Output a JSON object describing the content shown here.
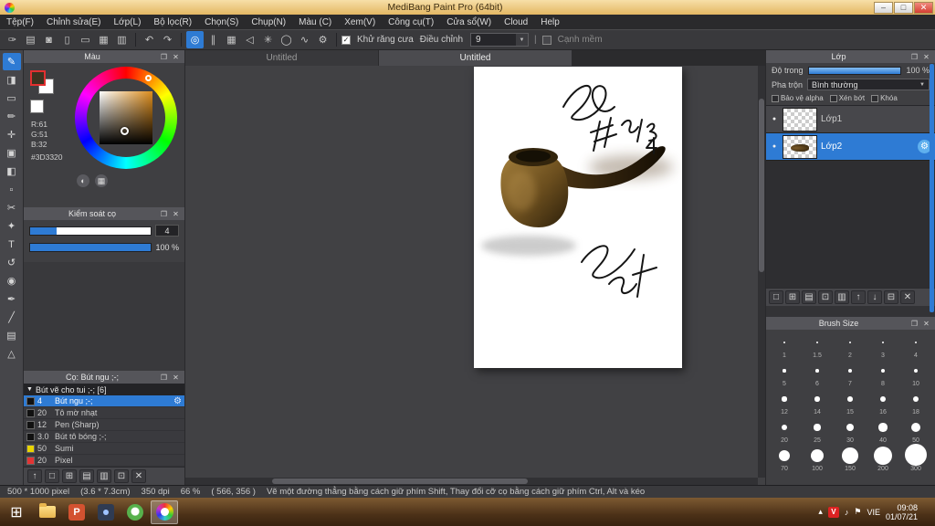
{
  "window": {
    "title": "MediBang Paint Pro (64bit)",
    "minimize_glyph": "–",
    "maximize_glyph": "□",
    "close_glyph": "✕"
  },
  "menu": {
    "items": [
      "Tệp(F)",
      "Chỉnh sửa(E)",
      "Lớp(L)",
      "Bộ lọc(R)",
      "Chọn(S)",
      "Chụp(N)",
      "Màu (C)",
      "Xem(V)",
      "Công cụ(T)",
      "Cửa sổ(W)",
      "Cloud",
      "Help"
    ]
  },
  "toolbar": {
    "left_icons": [
      {
        "name": "brush-cursor",
        "glyph": "✑"
      },
      {
        "name": "clipboard",
        "glyph": "▤"
      },
      {
        "name": "comment",
        "glyph": "◙"
      },
      {
        "name": "page-portrait",
        "glyph": "▯"
      },
      {
        "name": "page-landscape",
        "glyph": "▭"
      },
      {
        "name": "grid",
        "glyph": "▦"
      },
      {
        "name": "materials",
        "glyph": "▥"
      }
    ],
    "undo_glyph": "↶",
    "redo_glyph": "↷",
    "snap_icons": [
      {
        "name": "snap-off",
        "glyph": "◎"
      },
      {
        "name": "snap-parallel",
        "glyph": "∥"
      },
      {
        "name": "snap-grid",
        "glyph": "▦"
      },
      {
        "name": "snap-vanishing",
        "glyph": "◁"
      },
      {
        "name": "snap-radial",
        "glyph": "✳"
      },
      {
        "name": "snap-ellipse",
        "glyph": "◯"
      },
      {
        "name": "snap-curve",
        "glyph": "∿"
      },
      {
        "name": "snap-settings",
        "glyph": "⚙"
      }
    ],
    "antialias_label": "Khử răng cưa",
    "check_glyph": "✓",
    "adjust_label": "Điều chỉnh",
    "adjust_value": "9",
    "dropdown_glyph": "▼",
    "separator_glyph": "|",
    "soft_edge_label": "Cạnh mềm"
  },
  "toolstrip": {
    "tools": [
      {
        "name": "brush-tool",
        "glyph": "✎"
      },
      {
        "name": "eraser-tool",
        "glyph": "◨"
      },
      {
        "name": "select-rect-tool",
        "glyph": "▭"
      },
      {
        "name": "brush-2-tool",
        "glyph": "✏"
      },
      {
        "name": "move-tool",
        "glyph": "✛"
      },
      {
        "name": "fill-tool",
        "glyph": "▣"
      },
      {
        "name": "gradient-tool",
        "glyph": "◧"
      },
      {
        "name": "marquee-tool",
        "glyph": "▫"
      },
      {
        "name": "lasso-tool",
        "glyph": "✂"
      },
      {
        "name": "magic-wand-tool",
        "glyph": "✦"
      },
      {
        "name": "text-tool",
        "glyph": "T"
      },
      {
        "name": "rotate-tool",
        "glyph": "↺"
      },
      {
        "name": "eyedropper-tool",
        "glyph": "◉"
      },
      {
        "name": "pen-tool",
        "glyph": "✒"
      },
      {
        "name": "divide-tool",
        "glyph": "╱"
      },
      {
        "name": "material-tool",
        "glyph": "▤"
      },
      {
        "name": "measure-tool",
        "glyph": "△"
      }
    ]
  },
  "color_panel": {
    "title": "Màu",
    "r": "R:61",
    "g": "G:51",
    "b": "B:32",
    "hex": "#3D3320",
    "current_color": "#3D3320",
    "icon_spectrum": "◐",
    "icon_grid": "▦"
  },
  "brush_control": {
    "title": "Kiểm soát cọ",
    "size_value": "4",
    "opacity_value": "100 %"
  },
  "brush_panel": {
    "title": "Cọ: Bút ngu ;-;",
    "group_label": "Bút vẽ cho tui ;-; [6]",
    "group_arrow": "▼",
    "gear_glyph": "⚙",
    "brushes": [
      {
        "size": "4",
        "name": "Bút ngu ;-;",
        "swatch": "#111111"
      },
      {
        "size": "20",
        "name": "Tô mờ nhạt",
        "swatch": "#111111"
      },
      {
        "size": "12",
        "name": "Pen (Sharp)",
        "swatch": "#111111"
      },
      {
        "size": "3.0",
        "name": "Bút tô bóng ;-;",
        "swatch": "#111111"
      },
      {
        "size": "50",
        "name": "Sumi",
        "swatch": "#e8d400"
      },
      {
        "size": "20",
        "name": "Pixel",
        "swatch": "#e23434"
      }
    ],
    "footer_icons": [
      {
        "name": "collapse",
        "glyph": "↑"
      },
      {
        "name": "new-brush",
        "glyph": "□"
      },
      {
        "name": "save-brush",
        "glyph": "⊞"
      },
      {
        "name": "add-folder",
        "glyph": "▤"
      },
      {
        "name": "open-folder",
        "glyph": "▥"
      },
      {
        "name": "duplicate-brush",
        "glyph": "⊡"
      },
      {
        "name": "delete-brush",
        "glyph": "✕"
      }
    ]
  },
  "canvas": {
    "tabs": [
      "Untitled",
      "Untitled"
    ]
  },
  "layers_panel": {
    "title": "Lớp",
    "opacity_label": "Độ trong",
    "opacity_value": "100 %",
    "blend_label": "Pha trộn",
    "blend_value": "Bình thường",
    "checkboxes": [
      "Bảo vệ alpha",
      "Xén bớt",
      "Khóa"
    ],
    "eye_glyph": "●",
    "gear_glyph": "⚙",
    "layers": [
      {
        "name": "Lớp1"
      },
      {
        "name": "Lớp2"
      }
    ],
    "footer_icons": [
      {
        "name": "new-layer",
        "glyph": "□"
      },
      {
        "name": "new-folder",
        "glyph": "⊞"
      },
      {
        "name": "duplicate-layer",
        "glyph": "▤"
      },
      {
        "name": "merge-down",
        "glyph": "⊡"
      },
      {
        "name": "clear-layer",
        "glyph": "▥"
      },
      {
        "name": "move-up",
        "glyph": "↑"
      },
      {
        "name": "move-down",
        "glyph": "↓"
      },
      {
        "name": "combine",
        "glyph": "⊟"
      },
      {
        "name": "delete-layer",
        "glyph": "✕"
      }
    ]
  },
  "brush_size_panel": {
    "title": "Brush Size",
    "sizes": [
      "1",
      "1.5",
      "2",
      "3",
      "4",
      "5",
      "6",
      "7",
      "8",
      "10",
      "12",
      "14",
      "15",
      "16",
      "18",
      "20",
      "25",
      "30",
      "40",
      "50",
      "70",
      "100",
      "150",
      "200",
      "300"
    ]
  },
  "status": {
    "size": "500 * 1000 pixel",
    "dimensions": "(3.6 * 7.3cm)",
    "dpi": "350 dpi",
    "zoom": "66 %",
    "coords": "( 566, 356 )",
    "hint": "Vẽ một đường thẳng bằng cách giữ phím Shift, Thay đổi cỡ cọ bằng cách giữ phím Ctrl, Alt và kéo"
  },
  "taskbar": {
    "start_glyph": "⊞",
    "powerpoint_label": "P",
    "language": "VIE",
    "time": "09:08",
    "date": "01/07/21",
    "tray": [
      {
        "name": "hidden-icons",
        "glyph": "▴"
      },
      {
        "name": "antivirus",
        "glyph": "V"
      },
      {
        "name": "volume",
        "glyph": "♪"
      },
      {
        "name": "network",
        "glyph": "⚑"
      }
    ]
  },
  "panel_icons": {
    "popout": "❐",
    "close": "✕"
  },
  "colors": {
    "accent": "#2e7bd4",
    "titlebar": "#e3b763",
    "selection": "#2e7bd4"
  }
}
